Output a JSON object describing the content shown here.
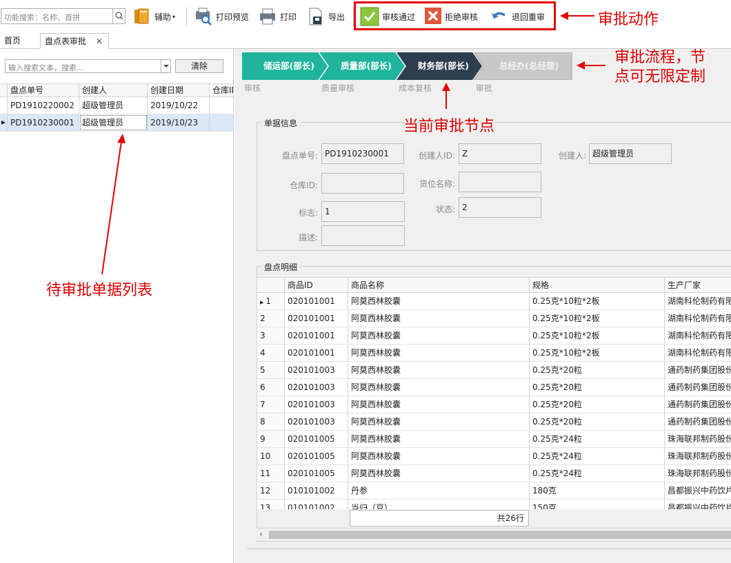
{
  "toolbar": {
    "func_search_placeholder": "功能搜索：名称、首拼",
    "assist_label": "辅助",
    "print_preview_label": "打印预览",
    "print_label": "打印",
    "export_label": "导出",
    "approve_label": "审核通过",
    "reject_label": "拒绝审核",
    "return_label": "退回重审"
  },
  "tabs": [
    {
      "label": "首页"
    },
    {
      "label": "盘点表审批",
      "close": "✕"
    }
  ],
  "left": {
    "search_placeholder": "输入搜索文本，搜索...",
    "clear_label": "清除",
    "columns": [
      "盘点单号",
      "创建人",
      "创建日期",
      "仓库ID"
    ],
    "rows": [
      [
        "PD1910220002",
        "超级管理员",
        "2019/10/22",
        ""
      ],
      [
        "PD1910230001",
        "超级管理员",
        "2019/10/23",
        ""
      ]
    ]
  },
  "flow": {
    "steps": [
      {
        "label": "储运部(部长)",
        "sub": "审核",
        "state": "done"
      },
      {
        "label": "质量部(部长)",
        "sub": "质量审核",
        "state": "done"
      },
      {
        "label": "财务部(部长)",
        "sub": "成本复核",
        "state": "current"
      },
      {
        "label": "总经办(总经理)",
        "sub": "审批",
        "state": "pending"
      }
    ]
  },
  "doc_info": {
    "title": "单据信息",
    "fields": {
      "doc_no": {
        "label": "盘点单号:",
        "value": "PD1910230001"
      },
      "creator_id": {
        "label": "创建人ID:",
        "value": "Z"
      },
      "creator": {
        "label": "创建人:",
        "value": "超级管理员"
      },
      "warehouse_id": {
        "label": "仓库ID:",
        "value": ""
      },
      "location_name": {
        "label": "货位名称:",
        "value": ""
      },
      "flag": {
        "label": "标志:",
        "value": "1"
      },
      "status": {
        "label": "状态:",
        "value": "2"
      },
      "desc": {
        "label": "描述:",
        "value": ""
      }
    }
  },
  "detail": {
    "title": "盘点明细",
    "columns": [
      "",
      "商品ID",
      "商品名称",
      "规格",
      "生产厂家"
    ],
    "rows": [
      [
        "1",
        "020101001",
        "阿莫西林胶囊",
        "0.25克*10粒*2板",
        "湖南科伦制药有限公司"
      ],
      [
        "2",
        "020101001",
        "阿莫西林胶囊",
        "0.25克*10粒*2板",
        "湖南科伦制药有限公司"
      ],
      [
        "3",
        "020101001",
        "阿莫西林胶囊",
        "0.25克*10粒*2板",
        "湖南科伦制药有限公司"
      ],
      [
        "4",
        "020101001",
        "阿莫西林胶囊",
        "0.25克*10粒*2板",
        "湖南科伦制药有限公司"
      ],
      [
        "5",
        "020101003",
        "阿莫西林胶囊",
        "0.25克*20粒",
        "通药制药集团股份有限公司"
      ],
      [
        "6",
        "020101003",
        "阿莫西林胶囊",
        "0.25克*20粒",
        "通药制药集团股份有限公司"
      ],
      [
        "7",
        "020101003",
        "阿莫西林胶囊",
        "0.25克*20粒",
        "通药制药集团股份有限公司"
      ],
      [
        "8",
        "020101003",
        "阿莫西林胶囊",
        "0.25克*20粒",
        "通药制药集团股份有限公司"
      ],
      [
        "9",
        "020101005",
        "阿莫西林胶囊",
        "0.25克*24粒",
        "珠海联邦制药股份有限公司"
      ],
      [
        "10",
        "020101005",
        "阿莫西林胶囊",
        "0.25克*24粒",
        "珠海联邦制药股份有限公司"
      ],
      [
        "11",
        "020101005",
        "阿莫西林胶囊",
        "0.25克*24粒",
        "珠海联邦制药股份有限公司"
      ],
      [
        "12",
        "010101002",
        "丹参",
        "180克",
        "昌都振兴中药饮片"
      ],
      [
        "13",
        "010101002",
        "当归（豆）",
        "150克",
        "昌都振兴中药饮片"
      ]
    ],
    "total": "共26行"
  },
  "annotations": {
    "action": "审批动作",
    "flow": "审批流程，节点可无限定制",
    "current": "当前审批节点",
    "list": "待审批单据列表"
  },
  "colors": {
    "step_done": "#1fb49b",
    "step_current": "#2d3e50",
    "step_pending": "#c8c8c8",
    "annotation": "#e00000"
  }
}
